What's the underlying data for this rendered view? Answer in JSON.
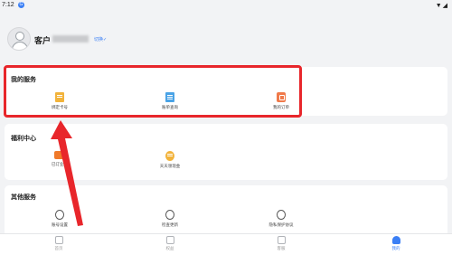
{
  "statusbar": {
    "time": "7:12",
    "notif": "G",
    "signal": "▼◢"
  },
  "profile": {
    "name": "客户",
    "edit_label": "切换✓"
  },
  "sections": {
    "my_services": {
      "title": "我的服务",
      "items": [
        {
          "label": "绑定卡号",
          "icon": "card-icon"
        },
        {
          "label": "账单查询",
          "icon": "document-icon"
        },
        {
          "label": "我的订单",
          "icon": "order-icon"
        }
      ]
    },
    "welfare": {
      "title": "福利中心",
      "items": [
        {
          "label": "已订业务",
          "icon": "subscription-icon"
        },
        {
          "label": "天天领现金",
          "icon": "coin-icon"
        }
      ]
    },
    "other": {
      "title": "其他服务",
      "items": [
        {
          "label": "账号设置",
          "icon": "settings-icon"
        },
        {
          "label": "检查更新",
          "icon": "cloud-update-icon"
        },
        {
          "label": "隐私保护协议",
          "icon": "shield-icon"
        }
      ]
    }
  },
  "tabs": [
    {
      "label": "首页",
      "icon": "home-icon",
      "active": false
    },
    {
      "label": "权益",
      "icon": "benefits-icon",
      "active": false
    },
    {
      "label": "客服",
      "icon": "chat-icon",
      "active": false
    },
    {
      "label": "我的",
      "icon": "profile-icon",
      "active": true
    }
  ],
  "colors": {
    "highlight": "#e8262b",
    "accent": "#3b7ff5",
    "background": "#f2f3f5"
  }
}
